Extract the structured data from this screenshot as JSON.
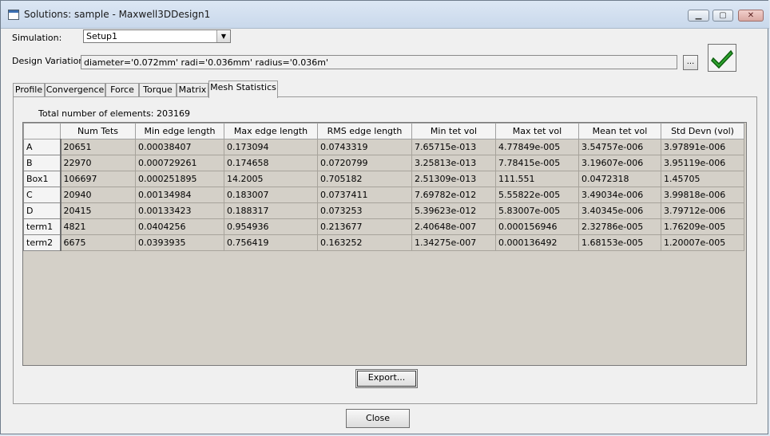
{
  "window": {
    "title": "Solutions: sample - Maxwell3DDesign1"
  },
  "simulation": {
    "label": "Simulation:",
    "value": "Setup1"
  },
  "design_variation": {
    "label": "Design Variation:",
    "value": "diameter='0.072mm' radi='0.036mm' radius='0.036m'",
    "browse_label": "..."
  },
  "tabs": [
    {
      "label": "Profile",
      "active": false
    },
    {
      "label": "Convergence",
      "active": false
    },
    {
      "label": "Force",
      "active": false
    },
    {
      "label": "Torque",
      "active": false
    },
    {
      "label": "Matrix",
      "active": false
    },
    {
      "label": "Mesh Statistics",
      "active": true
    }
  ],
  "mesh": {
    "total_label": "Total number of elements:",
    "total_value": "203169",
    "columns": [
      "",
      "Num Tets",
      "Min edge length",
      "Max edge length",
      "RMS edge length",
      "Min tet vol",
      "Max tet vol",
      "Mean tet vol",
      "Std Devn (vol)"
    ],
    "rows": [
      [
        "A",
        "20651",
        "0.00038407",
        "0.173094",
        "0.0743319",
        "7.65715e-013",
        "4.77849e-005",
        "3.54757e-006",
        "3.97891e-006"
      ],
      [
        "B",
        "22970",
        "0.000729261",
        "0.174658",
        "0.0720799",
        "3.25813e-013",
        "7.78415e-005",
        "3.19607e-006",
        "3.95119e-006"
      ],
      [
        "Box1",
        "106697",
        "0.000251895",
        "14.2005",
        "0.705182",
        "2.51309e-013",
        "111.551",
        "0.0472318",
        "1.45705"
      ],
      [
        "C",
        "20940",
        "0.00134984",
        "0.183007",
        "0.0737411",
        "7.69782e-012",
        "5.55822e-005",
        "3.49034e-006",
        "3.99818e-006"
      ],
      [
        "D",
        "20415",
        "0.00133423",
        "0.188317",
        "0.073253",
        "5.39623e-012",
        "5.83007e-005",
        "3.40345e-006",
        "3.79712e-006"
      ],
      [
        "term1",
        "4821",
        "0.0404256",
        "0.954936",
        "0.213677",
        "2.40648e-007",
        "0.000156946",
        "2.32786e-005",
        "1.76209e-005"
      ],
      [
        "term2",
        "6675",
        "0.0393935",
        "0.756419",
        "0.163252",
        "1.34275e-007",
        "0.000136492",
        "1.68153e-005",
        "1.20007e-005"
      ]
    ]
  },
  "buttons": {
    "export": "Export...",
    "close": "Close"
  },
  "colors": {
    "grid_background": "#d4d0c8",
    "check_green": "#2fa830"
  }
}
